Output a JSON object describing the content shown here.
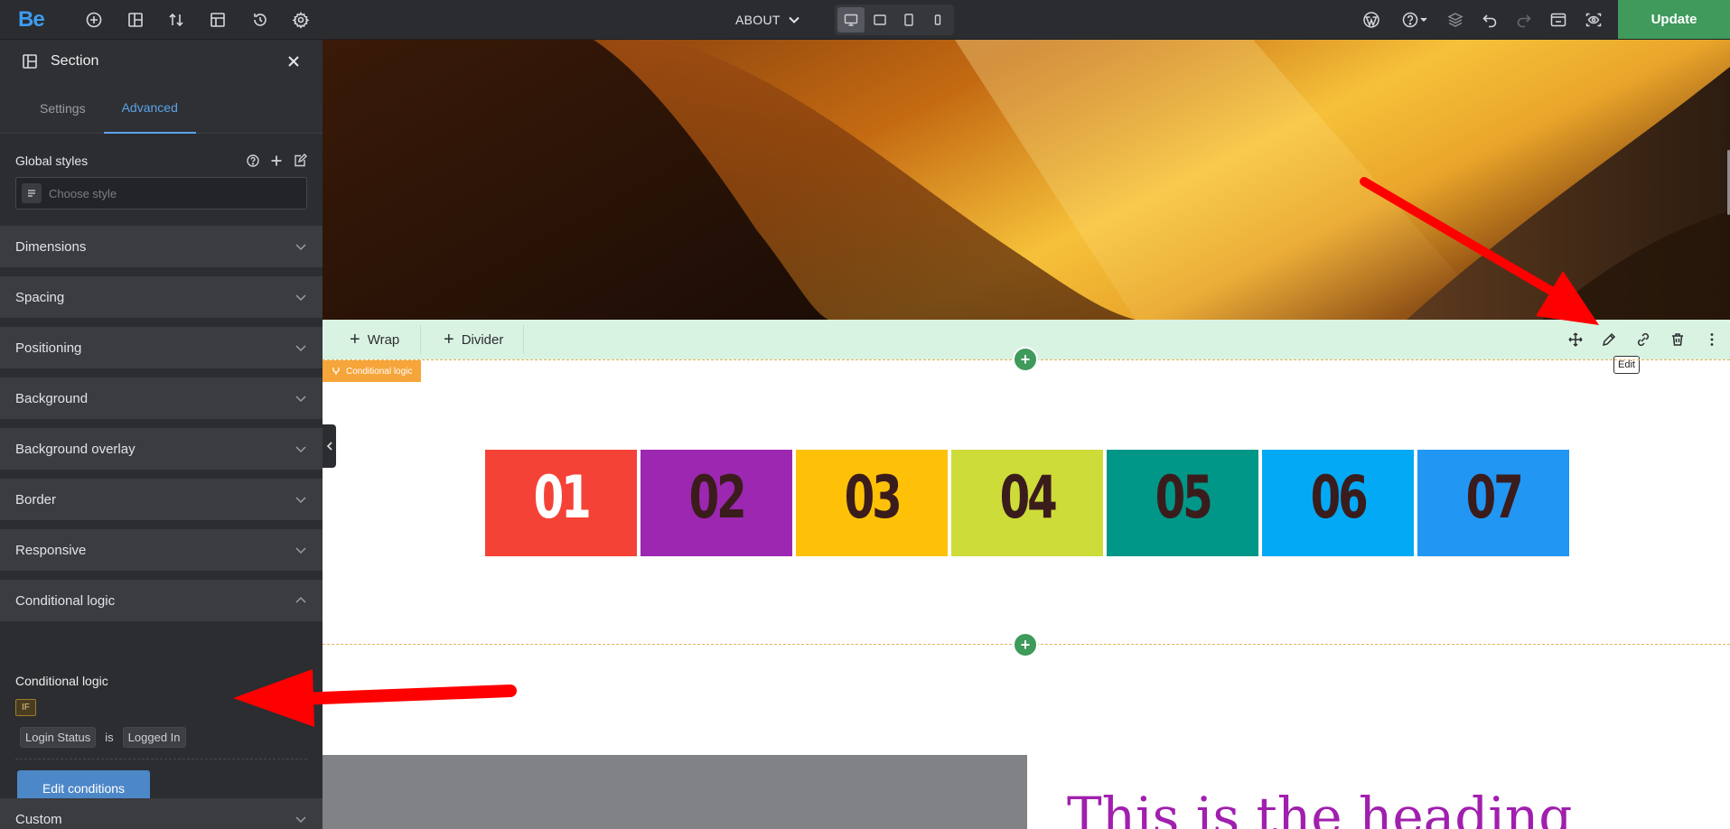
{
  "topbar": {
    "logo": "Be",
    "page_name": "ABOUT",
    "update_label": "Update",
    "left_icons": [
      "add-icon",
      "layout-icon",
      "sort-icon",
      "template-icon",
      "history-icon",
      "settings-icon"
    ],
    "right_icons": [
      "wordpress-icon",
      "help-icon",
      "layers-icon",
      "undo-icon",
      "redo-icon",
      "preview-icon",
      "view-icon"
    ],
    "devices": [
      "desktop",
      "laptop",
      "tablet",
      "mobile"
    ],
    "active_device": "desktop"
  },
  "sidebar": {
    "title": "Section",
    "tabs": [
      {
        "label": "Settings",
        "active": false
      },
      {
        "label": "Advanced",
        "active": true
      }
    ],
    "global_styles": {
      "label": "Global styles",
      "placeholder": "Choose style"
    },
    "accordions": [
      {
        "label": "Dimensions",
        "open": false
      },
      {
        "label": "Spacing",
        "open": false
      },
      {
        "label": "Positioning",
        "open": false
      },
      {
        "label": "Background",
        "open": false
      },
      {
        "label": "Background overlay",
        "open": false
      },
      {
        "label": "Border",
        "open": false
      },
      {
        "label": "Responsive",
        "open": false
      },
      {
        "label": "Conditional logic",
        "open": true
      },
      {
        "label": "Custom",
        "open": false
      }
    ],
    "conditional": {
      "title": "Conditional logic",
      "if_label": "IF",
      "field": "Login Status",
      "operator": "is",
      "value": "Logged In",
      "edit_button": "Edit conditions"
    }
  },
  "canvas": {
    "toolbar": {
      "wrap_label": "Wrap",
      "divider_label": "Divider",
      "edit_tooltip": "Edit"
    },
    "section_tag": "Conditional logic",
    "numbers": [
      {
        "text": "01",
        "bg": "#f44336",
        "fg": "#ffffff"
      },
      {
        "text": "02",
        "bg": "#9c27b0",
        "fg": "#3b1c1c"
      },
      {
        "text": "03",
        "bg": "#ffc107",
        "fg": "#3b1c1c"
      },
      {
        "text": "04",
        "bg": "#cddc39",
        "fg": "#3b1c1c"
      },
      {
        "text": "05",
        "bg": "#009688",
        "fg": "#3b1c1c"
      },
      {
        "text": "06",
        "bg": "#03a9f4",
        "fg": "#3b1c1c"
      },
      {
        "text": "07",
        "bg": "#2196f3",
        "fg": "#3b1c1c"
      }
    ],
    "heading": "This is the heading"
  },
  "colors": {
    "accent_green": "#3f9a5c",
    "accent_blue": "#5da3ea",
    "annotation_arrow": "#ff0000",
    "heading_purple": "#a11fae"
  }
}
